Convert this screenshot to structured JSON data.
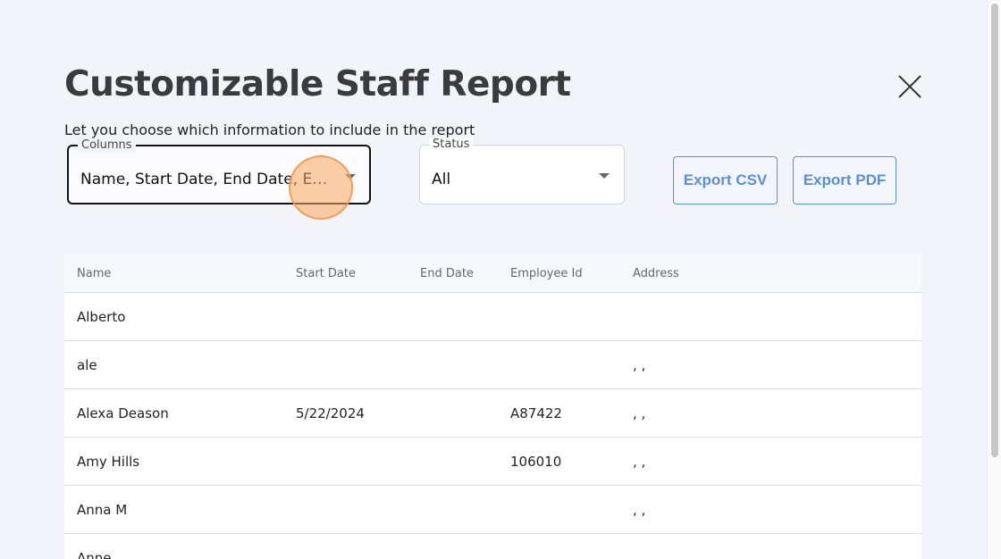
{
  "header": {
    "title": "Customizable Staff Report",
    "subtitle": "Let you choose which information to include in the report",
    "close_icon": "close-icon"
  },
  "filters": {
    "columns": {
      "label": "Columns",
      "value": "Name, Start Date, End Date, Employee Id, Address"
    },
    "status": {
      "label": "Status",
      "value": "All"
    }
  },
  "actions": {
    "export_csv": "Export CSV",
    "export_pdf": "Export PDF"
  },
  "table": {
    "columns": [
      "Name",
      "Start Date",
      "End Date",
      "Employee Id",
      "Address"
    ],
    "rows": [
      {
        "name": "Alberto",
        "start_date": "",
        "end_date": "",
        "employee_id": "",
        "address": ""
      },
      {
        "name": "ale",
        "start_date": "",
        "end_date": "",
        "employee_id": "",
        "address": ", ,"
      },
      {
        "name": "Alexa Deason",
        "start_date": "5/22/2024",
        "end_date": "",
        "employee_id": "A87422",
        "address": ", ,"
      },
      {
        "name": "Amy Hills",
        "start_date": "",
        "end_date": "",
        "employee_id": "106010",
        "address": ", ,"
      },
      {
        "name": "Anna M",
        "start_date": "",
        "end_date": "",
        "employee_id": "",
        "address": ", ,"
      },
      {
        "name": "Anne",
        "start_date": "",
        "end_date": "",
        "employee_id": "",
        "address": ""
      }
    ]
  },
  "colors": {
    "accent": "#5b8fd3",
    "background": "#f3f4f9",
    "highlight": "#f9a861"
  }
}
